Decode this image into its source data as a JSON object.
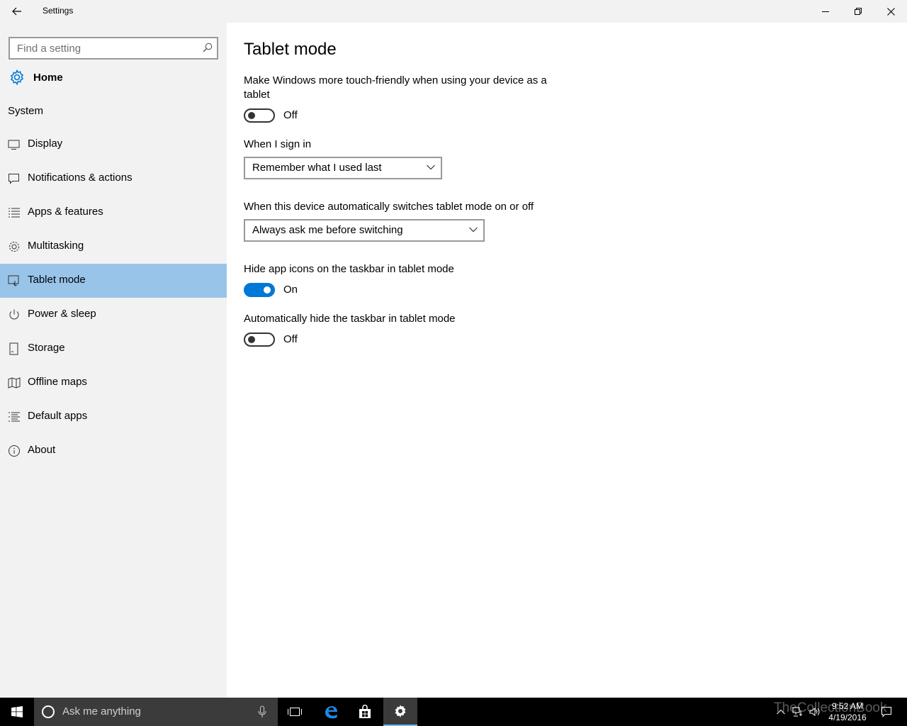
{
  "window": {
    "title": "Settings"
  },
  "sidebar": {
    "search_placeholder": "Find a setting",
    "home_label": "Home",
    "section_label": "System",
    "items": [
      {
        "label": "Display",
        "icon": "display-icon"
      },
      {
        "label": "Notifications & actions",
        "icon": "notifications-icon"
      },
      {
        "label": "Apps & features",
        "icon": "apps-list-icon"
      },
      {
        "label": "Multitasking",
        "icon": "multitasking-icon"
      },
      {
        "label": "Tablet mode",
        "icon": "tablet-mode-icon",
        "selected": true
      },
      {
        "label": "Power & sleep",
        "icon": "power-icon"
      },
      {
        "label": "Storage",
        "icon": "storage-icon"
      },
      {
        "label": "Offline maps",
        "icon": "map-icon"
      },
      {
        "label": "Default apps",
        "icon": "default-apps-icon"
      },
      {
        "label": "About",
        "icon": "info-icon"
      }
    ]
  },
  "main": {
    "title": "Tablet mode",
    "touch_friendly": {
      "description": "Make Windows more touch-friendly when using your device as a tablet",
      "state": "Off"
    },
    "sign_in": {
      "label": "When I sign in",
      "value": "Remember what I used last"
    },
    "auto_switch": {
      "label": "When this device automatically switches tablet mode on or off",
      "value": "Always ask me before switching"
    },
    "hide_icons": {
      "label": "Hide app icons on the taskbar in tablet mode",
      "state": "On"
    },
    "hide_taskbar": {
      "label": "Automatically hide the taskbar in tablet mode",
      "state": "Off"
    }
  },
  "taskbar": {
    "search_placeholder": "Ask me anything",
    "time": "9:52 AM",
    "date": "4/19/2016",
    "watermark": "TheCollectionBook"
  },
  "colors": {
    "accent": "#0078d7",
    "selected_nav": "#99c4ea",
    "sidebar_bg": "#f2f2f2"
  }
}
